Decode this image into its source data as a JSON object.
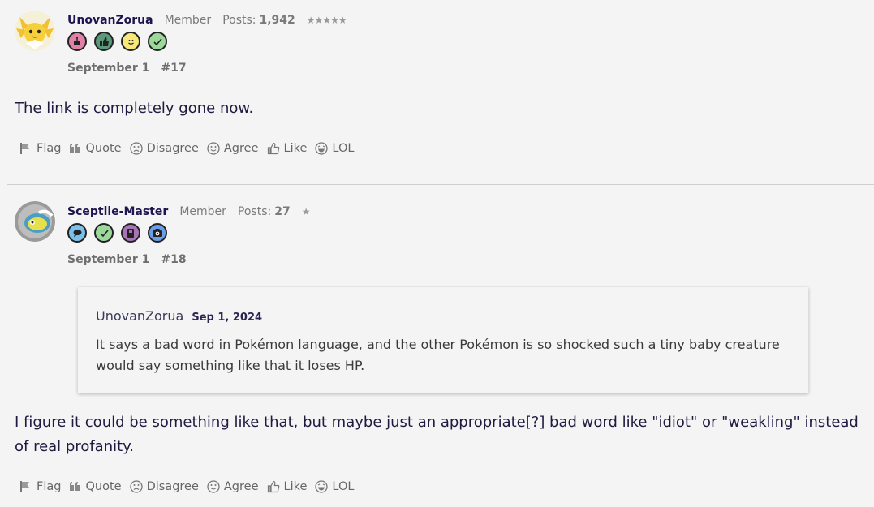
{
  "posts": [
    {
      "username": "UnovanZorua",
      "role": "Member",
      "posts_label": "Posts:",
      "posts_count": "1,942",
      "stars": "★★★★★",
      "date": "September 1",
      "number": "#17",
      "message": "The link is completely gone now.",
      "badges": [
        "cake-badge",
        "thumbs-up-badge",
        "smile-badge",
        "check-badge"
      ]
    },
    {
      "username": "Sceptile-Master",
      "role": "Member",
      "posts_label": "Posts:",
      "posts_count": "27",
      "stars": "★",
      "date": "September 1",
      "number": "#18",
      "quote": {
        "author": "UnovanZorua",
        "date": "Sep 1, 2024",
        "text": "It says a bad word in Pokémon language, and the other Pokémon is so shocked such a tiny baby creature would say something like that it loses HP."
      },
      "message": "I figure it could be something like that, but maybe just an appropriate[?] bad word like \"idiot\" or \"weakling\" instead of real profanity.",
      "badges": [
        "speech-bubble-badge",
        "check-badge",
        "notebook-badge",
        "camera-badge"
      ]
    }
  ],
  "actions": {
    "flag": "Flag",
    "quote": "Quote",
    "disagree": "Disagree",
    "agree": "Agree",
    "like": "Like",
    "lol": "LOL"
  }
}
